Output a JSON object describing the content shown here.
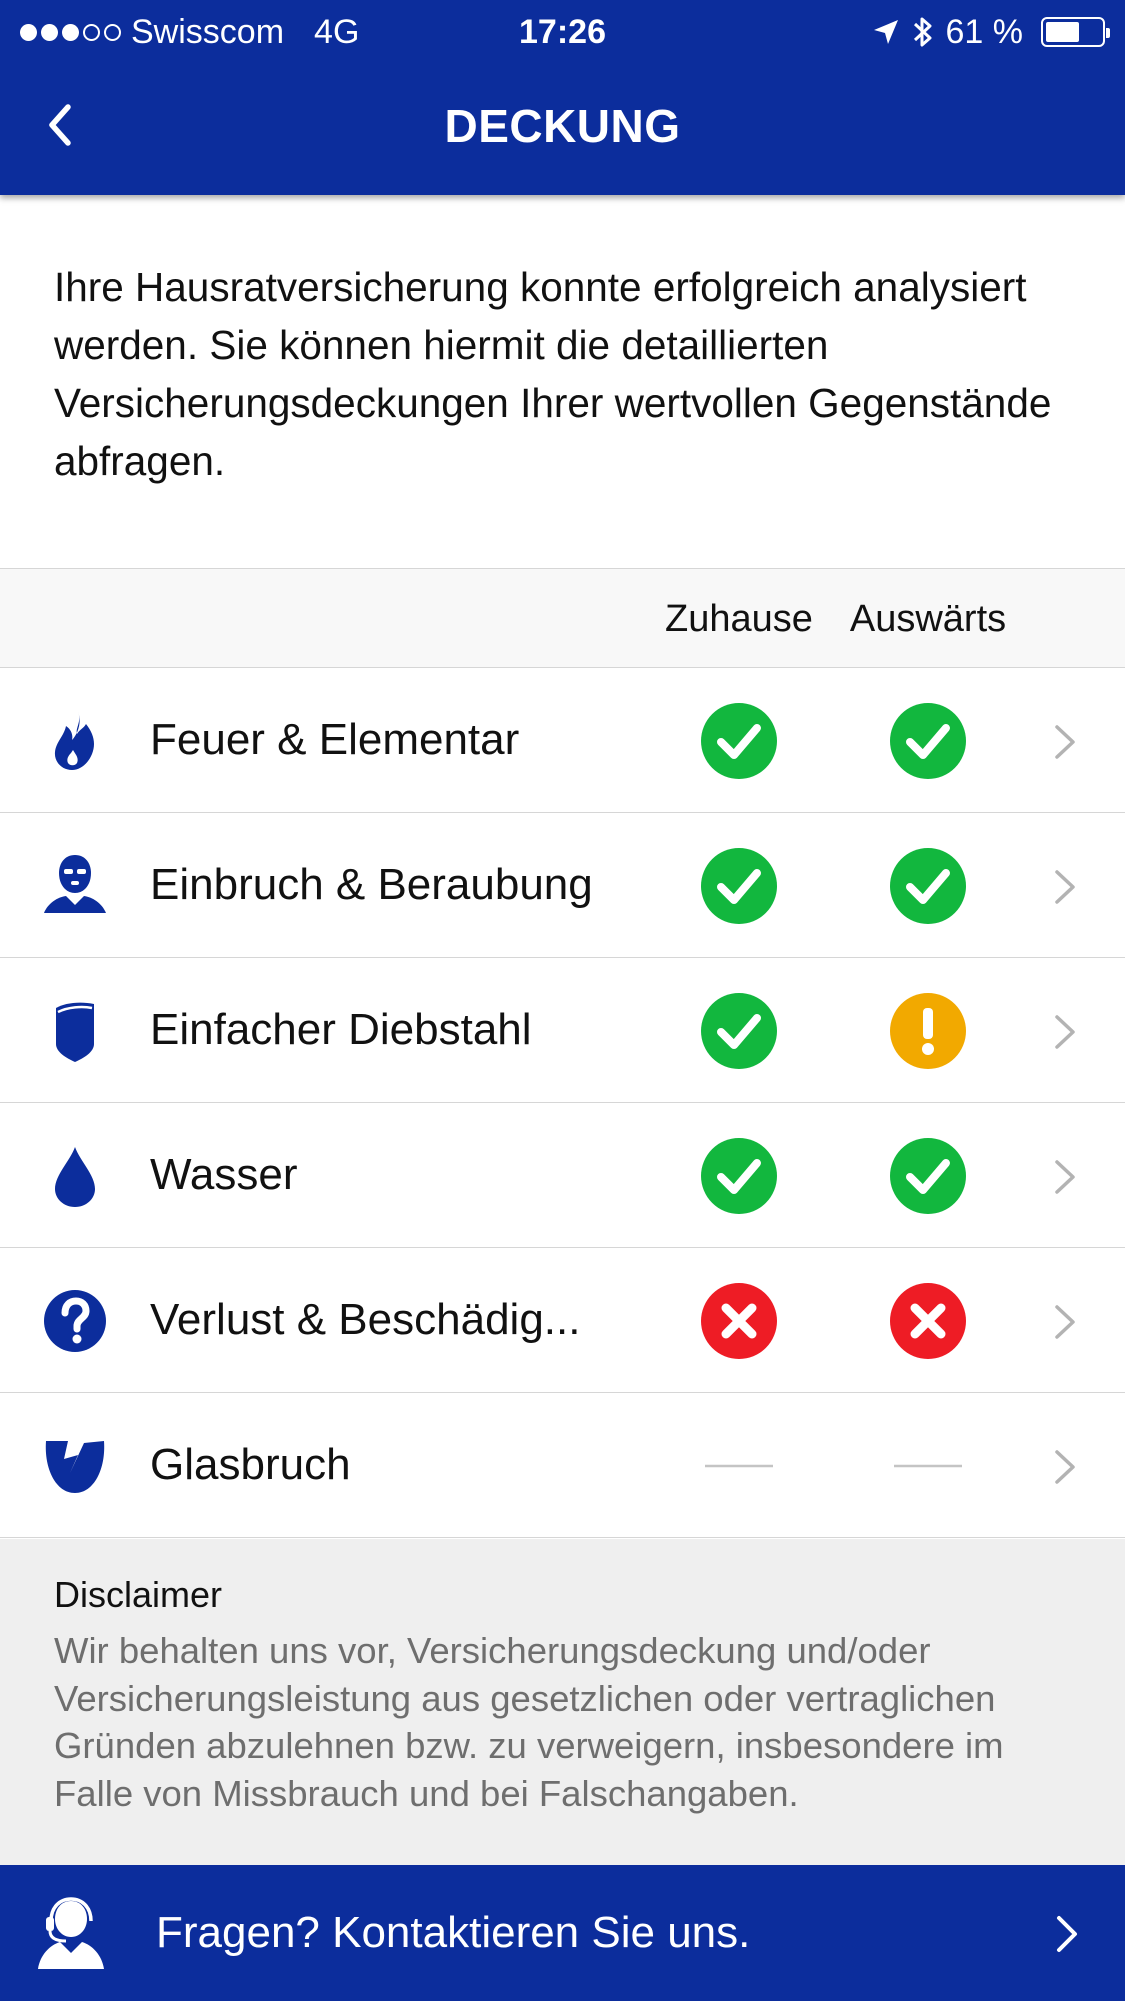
{
  "status_bar": {
    "carrier": "Swisscom",
    "network": "4G",
    "time": "17:26",
    "battery": "61 %",
    "battery_level": 0.61
  },
  "nav": {
    "title": "DECKUNG"
  },
  "intro": "Ihre Hausratversicherung konnte erfolgreich analysiert werden. Sie können hiermit die detaillierten Versicherungsdeckungen Ihrer wertvollen Gegenstände abfragen.",
  "columns": {
    "home": "Zuhause",
    "away": "Auswärts"
  },
  "rows": [
    {
      "label": "Feuer & Elementar",
      "icon": "flame-icon",
      "home": "covered",
      "away": "covered"
    },
    {
      "label": "Einbruch & Beraubung",
      "icon": "burglar-icon",
      "home": "covered",
      "away": "covered"
    },
    {
      "label": "Einfacher Diebstahl",
      "icon": "shield-icon",
      "home": "covered",
      "away": "warning"
    },
    {
      "label": "Wasser",
      "icon": "water-drop-icon",
      "home": "covered",
      "away": "covered"
    },
    {
      "label": "Verlust & Beschädig...",
      "icon": "question-icon",
      "home": "not-covered",
      "away": "not-covered"
    },
    {
      "label": "Glasbruch",
      "icon": "broken-glass-icon",
      "home": "none",
      "away": "none"
    }
  ],
  "disclaimer": {
    "title": "Disclaimer",
    "text": "Wir behalten uns vor, Versicherungsdeckung und/oder Versicherungsleistung aus gesetzlichen oder vertraglichen Gründen abzulehnen bzw. zu verweigern, insbesondere im Falle von Missbrauch und bei Falschangaben."
  },
  "footer": {
    "label": "Fragen? Kontaktieren Sie uns.",
    "icon": "support-agent-icon"
  },
  "colors": {
    "brand_blue": "#0c2d9c",
    "covered_green": "#12b73e",
    "warning_yellow": "#f2a900",
    "not_covered_red": "#ee1c25",
    "chevron_grey": "#b3b3b3"
  }
}
